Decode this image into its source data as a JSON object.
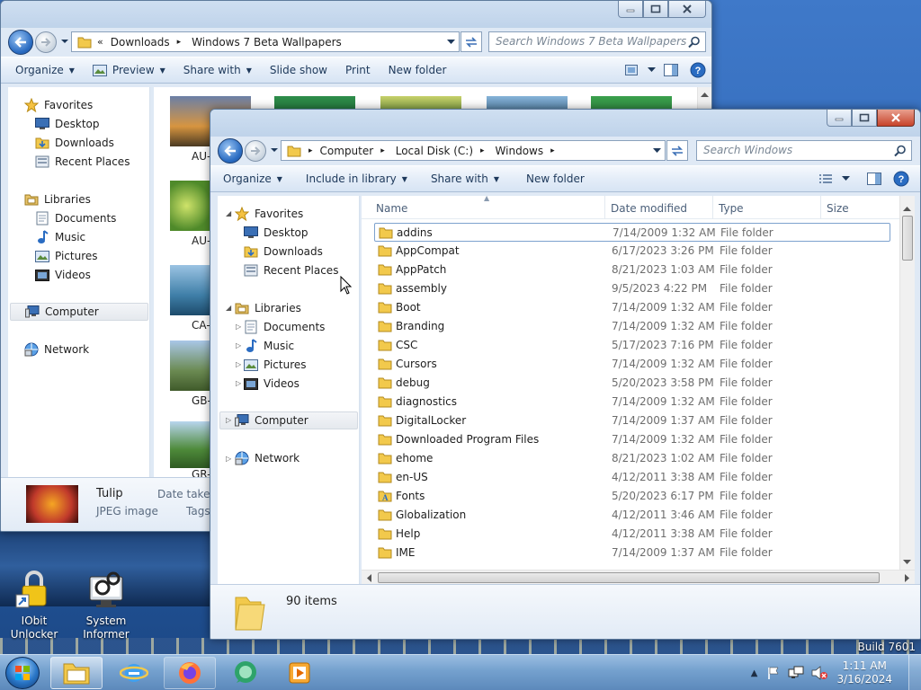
{
  "desktop": {
    "icons": [
      {
        "label": "IObit Unlocker"
      },
      {
        "label": "System Informer"
      }
    ],
    "build": "Build 7601"
  },
  "back_window": {
    "breadcrumb": [
      "Downloads",
      "Windows 7 Beta Wallpapers"
    ],
    "breadcrumb_overflow": "«",
    "search_placeholder": "Search Windows 7 Beta Wallpapers",
    "commands": [
      "Organize",
      "Preview",
      "Share with",
      "Slide show",
      "Print",
      "New folder"
    ],
    "nav": {
      "favorites": "Favorites",
      "favorites_items": [
        "Desktop",
        "Downloads",
        "Recent Places"
      ],
      "libraries": "Libraries",
      "libraries_items": [
        "Documents",
        "Music",
        "Pictures",
        "Videos"
      ],
      "computer": "Computer",
      "network": "Network"
    },
    "thumb_labels": [
      "AU-",
      "AU-",
      "CA-",
      "GB-",
      "GR-"
    ],
    "details": {
      "name": "Tulip",
      "type": "JPEG image",
      "date_label": "Date taken:",
      "tags_label": "Tags:"
    }
  },
  "front_window": {
    "breadcrumb": [
      "Computer",
      "Local Disk (C:)",
      "Windows"
    ],
    "search_placeholder": "Search Windows",
    "commands": [
      "Organize",
      "Include in library",
      "Share with",
      "New folder"
    ],
    "nav": {
      "favorites": "Favorites",
      "favorites_items": [
        "Desktop",
        "Downloads",
        "Recent Places"
      ],
      "libraries": "Libraries",
      "libraries_items": [
        "Documents",
        "Music",
        "Pictures",
        "Videos"
      ],
      "computer": "Computer",
      "network": "Network"
    },
    "columns": [
      "Name",
      "Date modified",
      "Type",
      "Size"
    ],
    "rows": [
      {
        "name": "addins",
        "date": "7/14/2009 1:32 AM",
        "type": "File folder"
      },
      {
        "name": "AppCompat",
        "date": "6/17/2023 3:26 PM",
        "type": "File folder"
      },
      {
        "name": "AppPatch",
        "date": "8/21/2023 1:03 AM",
        "type": "File folder"
      },
      {
        "name": "assembly",
        "date": "9/5/2023 4:22 PM",
        "type": "File folder"
      },
      {
        "name": "Boot",
        "date": "7/14/2009 1:32 AM",
        "type": "File folder"
      },
      {
        "name": "Branding",
        "date": "7/14/2009 1:32 AM",
        "type": "File folder"
      },
      {
        "name": "CSC",
        "date": "5/17/2023 7:16 PM",
        "type": "File folder"
      },
      {
        "name": "Cursors",
        "date": "7/14/2009 1:32 AM",
        "type": "File folder"
      },
      {
        "name": "debug",
        "date": "5/20/2023 3:58 PM",
        "type": "File folder"
      },
      {
        "name": "diagnostics",
        "date": "7/14/2009 1:32 AM",
        "type": "File folder"
      },
      {
        "name": "DigitalLocker",
        "date": "7/14/2009 1:37 AM",
        "type": "File folder"
      },
      {
        "name": "Downloaded Program Files",
        "date": "7/14/2009 1:32 AM",
        "type": "File folder"
      },
      {
        "name": "ehome",
        "date": "8/21/2023 1:02 AM",
        "type": "File folder"
      },
      {
        "name": "en-US",
        "date": "4/12/2011 3:38 AM",
        "type": "File folder"
      },
      {
        "name": "Fonts",
        "date": "5/20/2023 6:17 PM",
        "type": "File folder"
      },
      {
        "name": "Globalization",
        "date": "4/12/2011 3:46 AM",
        "type": "File folder"
      },
      {
        "name": "Help",
        "date": "4/12/2011 3:38 AM",
        "type": "File folder"
      },
      {
        "name": "IME",
        "date": "7/14/2009 1:37 AM",
        "type": "File folder"
      }
    ],
    "status": "90 items"
  },
  "taskbar": {
    "time": "1:11 AM",
    "date": "3/16/2024"
  },
  "colors": {
    "accent": "#2a6cc2",
    "folder": "#f2c94c",
    "selection_border": "#7da2ce",
    "close_button": "#c7432a"
  }
}
